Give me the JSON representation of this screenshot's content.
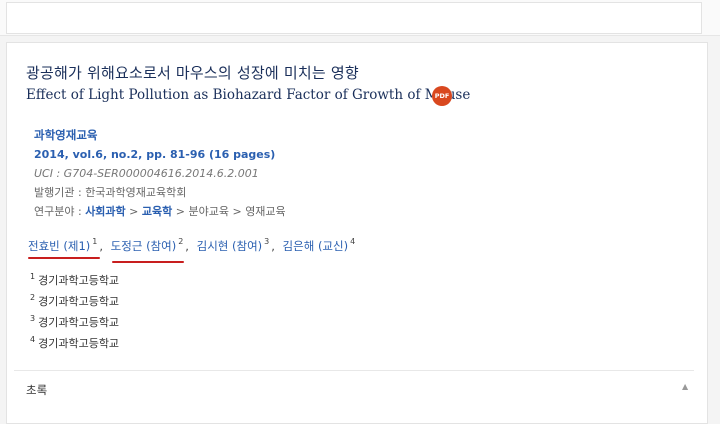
{
  "paper": {
    "title_ko": "광공해가 위해요소로서 마우스의 성장에 미치는 영향",
    "title_en": "Effect of Light Pollution as Biohazard Factor of Growth of Mouse",
    "pdf_icon": "pdf-icon",
    "pdf_label": "PDF"
  },
  "meta": {
    "journal": "과학영재교육",
    "volume": "2014, vol.6, no.2, pp. 81-96 (16 pages)",
    "uci": "UCI : G704-SER000004616.2014.6.2.001",
    "publisher_label": "발행기관 : ",
    "publisher": "한국과학영재교육학회",
    "field_label": "연구분야 : ",
    "field_1": "사회과학",
    "field_sep": " > ",
    "field_2": "교육학",
    "field_3": "분야교육",
    "field_4": "영재교육"
  },
  "authors": [
    {
      "name": "전효빈 (제1)",
      "sup": "1"
    },
    {
      "name": "도정근 (참여)",
      "sup": "2"
    },
    {
      "name": "김시현 (참여)",
      "sup": "3"
    },
    {
      "name": "김은해 (교신)",
      "sup": "4"
    }
  ],
  "affiliations": [
    {
      "sup": "1",
      "text": "경기과학고등학교"
    },
    {
      "sup": "2",
      "text": "경기과학고등학교"
    },
    {
      "sup": "3",
      "text": "경기과학고등학교"
    },
    {
      "sup": "4",
      "text": "경기과학고등학교"
    }
  ],
  "abstract": {
    "label": "초록",
    "toggle_icon": "chevron-up-icon",
    "toggle_glyph": "▲"
  },
  "colors": {
    "title": "#1a2f5a",
    "link": "#2a5fb0",
    "annotation_underline": "#c81e1e",
    "pdf_badge": "#d9481f"
  }
}
